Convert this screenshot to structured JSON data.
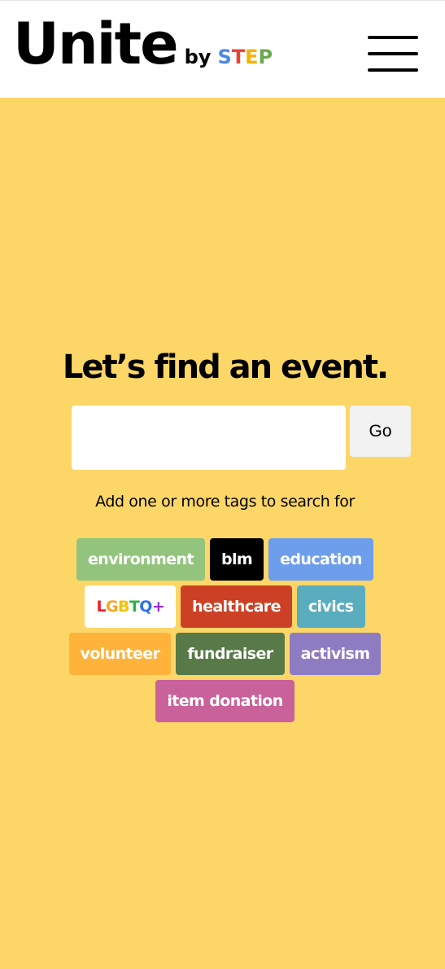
{
  "header": {
    "logo_main": "Unite",
    "logo_by": "by",
    "logo_step_letters": [
      {
        "char": "S",
        "color": "#4a86e8"
      },
      {
        "char": "T",
        "color": "#e94235"
      },
      {
        "char": "E",
        "color": "#f6b400"
      },
      {
        "char": "P",
        "color": "#6aa84f"
      }
    ],
    "menu_icon": "hamburger-menu-icon"
  },
  "main": {
    "heading": "Let’s find an event.",
    "search": {
      "value": "",
      "placeholder": ""
    },
    "go_label": "Go",
    "helper_text": "Add one or more tags to search for"
  },
  "tags": [
    [
      {
        "label": "environment",
        "color": "#93c47d"
      },
      {
        "label": "blm",
        "color": "#000000"
      },
      {
        "label": "education",
        "color": "#6d9eeb"
      }
    ],
    [
      {
        "label": "LGBTQ+",
        "color": "#ffffff",
        "rainbow": [
          "#e8222c",
          "#f5a623",
          "#f6c200",
          "#2fb344",
          "#2a73e8",
          "#9b27e0"
        ]
      },
      {
        "label": "healthcare",
        "color": "#cc4125"
      },
      {
        "label": "civics",
        "color": "#5aacbf"
      }
    ],
    [
      {
        "label": "volunteer",
        "color": "#ffb33b"
      },
      {
        "label": "fundraiser",
        "color": "#587a48"
      },
      {
        "label": "activism",
        "color": "#8e7cc3"
      }
    ],
    [
      {
        "label": "item donation",
        "color": "#c9619a"
      }
    ]
  ]
}
